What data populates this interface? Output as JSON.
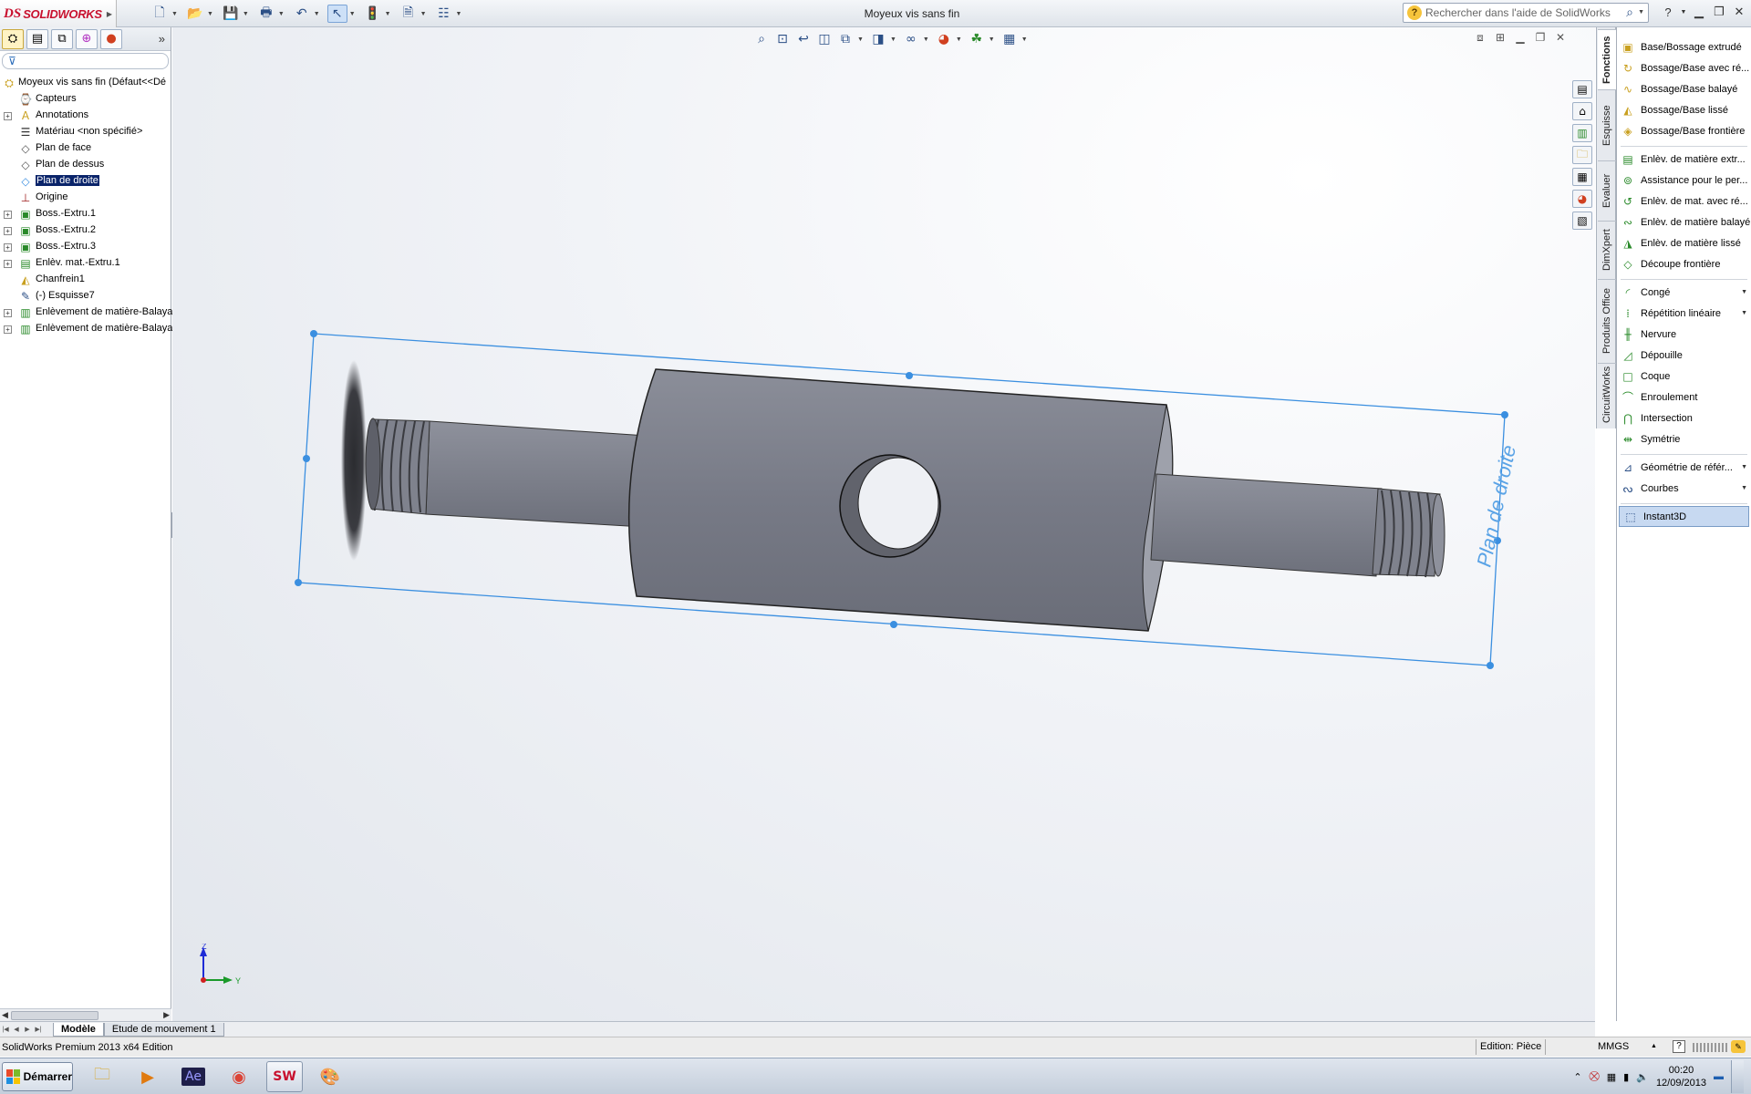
{
  "window": {
    "app_logo_ds": "DS",
    "app_logo_text": "SOLIDWORKS",
    "title": "Moyeux vis sans fin",
    "search_placeholder": "Rechercher dans l'aide de SolidWorks",
    "help_symbol": "?"
  },
  "quick_access": [
    {
      "name": "new-document-button",
      "icon": "new-doc-icon",
      "glyph": "🗋"
    },
    {
      "name": "open-button",
      "icon": "folder-open-icon",
      "glyph": "📂"
    },
    {
      "name": "save-button",
      "icon": "floppy-icon",
      "glyph": "💾"
    },
    {
      "name": "print-button",
      "icon": "printer-icon",
      "glyph": "🖶"
    },
    {
      "name": "undo-button",
      "icon": "undo-icon",
      "glyph": "↶"
    },
    {
      "name": "select-button",
      "icon": "cursor-icon",
      "glyph": "↖"
    },
    {
      "name": "rebuild-button",
      "icon": "traffic-light-icon",
      "glyph": "🚦"
    },
    {
      "name": "file-properties-button",
      "icon": "file-props-icon",
      "glyph": "🗎"
    },
    {
      "name": "options-button",
      "icon": "options-icon",
      "glyph": "☷"
    }
  ],
  "feature_manager": {
    "tabs": [
      "feature-tree-icon",
      "property-manager-icon",
      "configuration-manager-icon",
      "dimxpert-icon",
      "display-manager-icon"
    ],
    "filter_symbol": "⊽",
    "root": "Moyeux vis sans fin  (Défaut<<Dé",
    "items": [
      {
        "label": "Capteurs",
        "icon": "sensor-icon",
        "expandable": false
      },
      {
        "label": "Annotations",
        "icon": "annotations-icon",
        "expandable": true
      },
      {
        "label": "Matériau <non spécifié>",
        "icon": "material-icon",
        "expandable": false
      },
      {
        "label": "Plan de face",
        "icon": "plane-icon",
        "expandable": false
      },
      {
        "label": "Plan de dessus",
        "icon": "plane-icon",
        "expandable": false
      },
      {
        "label": "Plan de droite",
        "icon": "plane-icon",
        "expandable": false,
        "selected": true
      },
      {
        "label": "Origine",
        "icon": "origin-icon",
        "expandable": false
      },
      {
        "label": "Boss.-Extru.1",
        "icon": "extrude-boss-icon",
        "expandable": true
      },
      {
        "label": "Boss.-Extru.2",
        "icon": "extrude-boss-icon",
        "expandable": true
      },
      {
        "label": "Boss.-Extru.3",
        "icon": "extrude-boss-icon",
        "expandable": true
      },
      {
        "label": "Enlèv. mat.-Extru.1",
        "icon": "extrude-cut-icon",
        "expandable": true
      },
      {
        "label": "Chanfrein1",
        "icon": "chamfer-icon",
        "expandable": false
      },
      {
        "label": "(-) Esquisse7",
        "icon": "sketch-icon",
        "expandable": false
      },
      {
        "label": "Enlèvement de matière-Balaya",
        "icon": "swept-cut-icon",
        "expandable": true
      },
      {
        "label": "Enlèvement de matière-Balaya",
        "icon": "swept-cut-icon",
        "expandable": true
      }
    ]
  },
  "graphics": {
    "plane_label": "Plan de droite",
    "triad_z": "Z",
    "triad_y": "Y",
    "headsup": [
      "zoom-to-fit-icon",
      "zoom-to-area-icon",
      "previous-view-icon",
      "section-view-icon",
      "view-orientation-icon",
      "display-style-icon",
      "hide-show-icon",
      "edit-appearance-icon",
      "apply-scene-icon",
      "view-settings-icon"
    ]
  },
  "command_manager": {
    "tabs": [
      "Fonctions",
      "Esquisse",
      "Evaluer",
      "DimXpert",
      "Produits Office",
      "CircuitWorks"
    ],
    "active_tab": "Fonctions",
    "groups": [
      [
        {
          "label": "Base/Bossage extrudé",
          "icon": "extruded-boss-icon"
        },
        {
          "label": "Bossage/Base avec ré...",
          "icon": "revolved-boss-icon"
        },
        {
          "label": "Bossage/Base balayé",
          "icon": "swept-boss-icon"
        },
        {
          "label": "Bossage/Base lissé",
          "icon": "lofted-boss-icon"
        },
        {
          "label": "Bossage/Base frontière",
          "icon": "boundary-boss-icon"
        }
      ],
      [
        {
          "label": "Enlèv. de matière extr...",
          "icon": "extruded-cut-icon"
        },
        {
          "label": "Assistance pour le per...",
          "icon": "hole-wizard-icon"
        },
        {
          "label": "Enlèv. de mat. avec ré...",
          "icon": "revolved-cut-icon"
        },
        {
          "label": "Enlèv. de matière balayé",
          "icon": "swept-cut-icon"
        },
        {
          "label": "Enlèv. de matière lissé",
          "icon": "lofted-cut-icon"
        },
        {
          "label": "Découpe frontière",
          "icon": "boundary-cut-icon"
        }
      ],
      [
        {
          "label": "Congé",
          "icon": "fillet-icon",
          "dropdown": true
        },
        {
          "label": "Répétition linéaire",
          "icon": "linear-pattern-icon",
          "dropdown": true
        },
        {
          "label": "Nervure",
          "icon": "rib-icon"
        },
        {
          "label": "Dépouille",
          "icon": "draft-icon"
        },
        {
          "label": "Coque",
          "icon": "shell-icon"
        },
        {
          "label": "Enroulement",
          "icon": "wrap-icon"
        },
        {
          "label": "Intersection",
          "icon": "intersect-icon"
        },
        {
          "label": "Symétrie",
          "icon": "mirror-icon"
        }
      ],
      [
        {
          "label": "Géométrie de référ...",
          "icon": "reference-geometry-icon",
          "dropdown": true
        },
        {
          "label": "Courbes",
          "icon": "curves-icon",
          "dropdown": true
        }
      ],
      [
        {
          "label": "Instant3D",
          "icon": "instant3d-icon",
          "selected": true
        }
      ]
    ]
  },
  "task_pane_icons": [
    "solidworks-resources-icon",
    "home-icon",
    "design-library-icon",
    "file-explorer-icon",
    "view-palette-icon",
    "appearances-icon",
    "custom-properties-icon"
  ],
  "bottom_tabs": [
    "Modèle",
    "Etude de mouvement 1"
  ],
  "status": {
    "product": "SolidWorks Premium 2013 x64 Edition",
    "edit_mode": "Edition: Pièce",
    "units": "MMGS"
  },
  "taskbar": {
    "start_label": "Démarrer",
    "apps": [
      {
        "name": "file-explorer-icon",
        "glyph": "🗀"
      },
      {
        "name": "media-player-icon",
        "glyph": "▶"
      },
      {
        "name": "after-effects-icon",
        "glyph": "Ae"
      },
      {
        "name": "chrome-icon",
        "glyph": "◉"
      },
      {
        "name": "solidworks-taskbar-icon",
        "glyph": "SW"
      },
      {
        "name": "paint-icon",
        "glyph": "🎨"
      }
    ],
    "time": "00:20",
    "date": "12/09/2013"
  },
  "colors": {
    "selection_blue": "#3b8fe0",
    "part_gray": "#7d808b",
    "tree_selection": "#0a246a",
    "brand_red": "#c8102e"
  }
}
